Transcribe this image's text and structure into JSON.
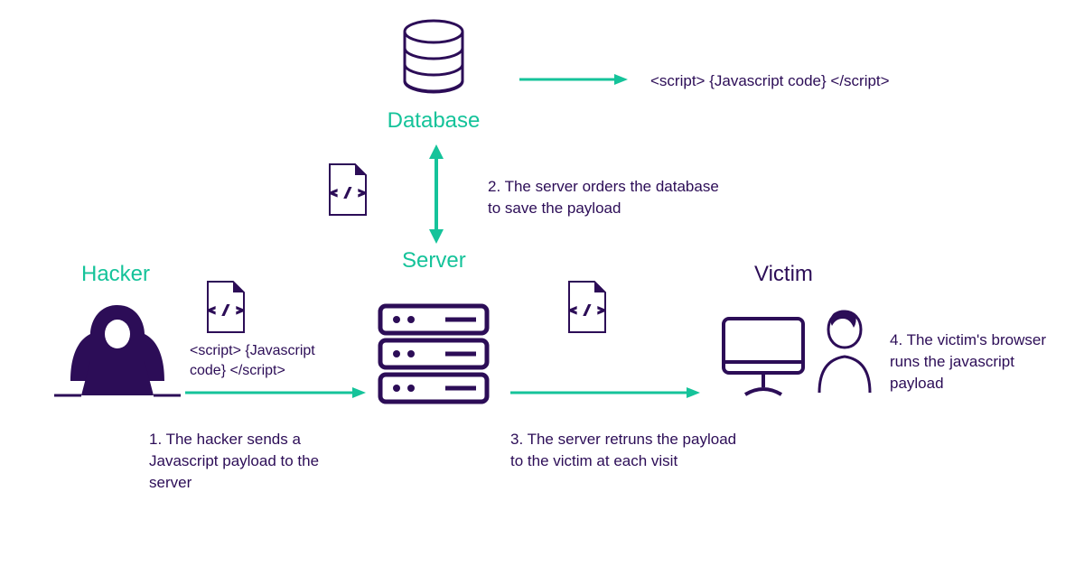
{
  "colors": {
    "purple": "#2c0d57",
    "teal": "#15c39a"
  },
  "labels": {
    "hacker": "Hacker",
    "server": "Server",
    "database": "Database",
    "victim": "Victim"
  },
  "payload_snippet": "<script> {Javascript code} </script>",
  "steps": {
    "step1": "1. The hacker sends a Javascript payload to the server",
    "step2": "2. The server orders the database to save the payload",
    "step3": "3. The server retruns the payload to the victim at each visit",
    "step4": "4. The victim's browser runs the javascript payload"
  }
}
